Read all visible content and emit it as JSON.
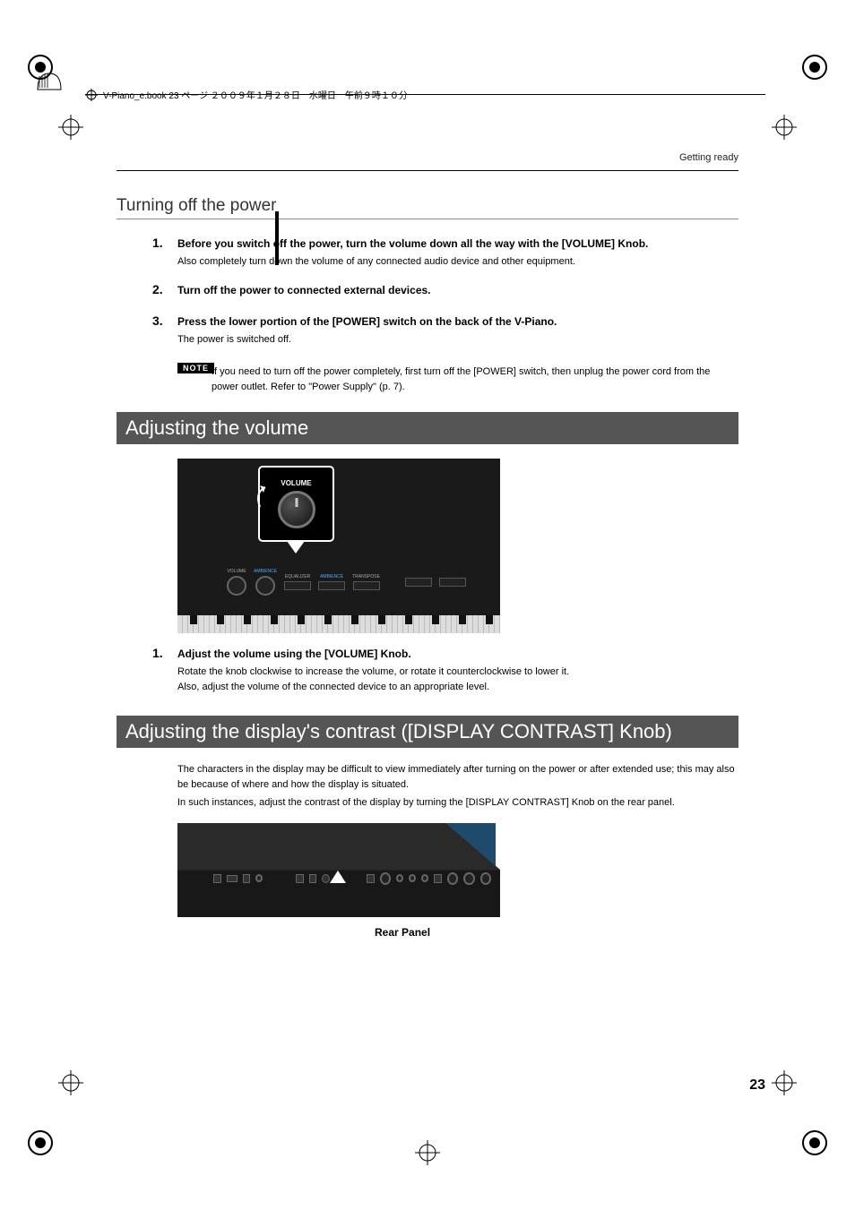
{
  "header": {
    "text": "V-Piano_e.book 23 ページ ２００９年１月２８日　水曜日　午前９時１０分"
  },
  "running_head": "Getting ready",
  "section_turning_off": {
    "title": "Turning off the power",
    "steps": [
      {
        "num": "1.",
        "title": "Before you switch off the power, turn the volume down all the way with the [VOLUME] Knob.",
        "body": "Also completely turn down the volume of any connected audio device and other equipment."
      },
      {
        "num": "2.",
        "title": "Turn off the power to connected external devices.",
        "body": ""
      },
      {
        "num": "3.",
        "title": "Press the lower portion of the [POWER] switch on the back of the V-Piano.",
        "body": "The power is switched off."
      }
    ],
    "note_tag": "NOTE",
    "note_text": "If you need to turn off the power completely, first turn off the [POWER] switch, then unplug the power cord from the power outlet. Refer to  \"Power Supply\" (p. 7)."
  },
  "section_volume": {
    "title": "Adjusting the volume",
    "figure_labels": {
      "callout": "VOLUME",
      "volume": "VOLUME",
      "ambience": "AMBIENCE",
      "equalizer": "EQUALIZER",
      "ambience2": "AMBIENCE",
      "transpose": "TRANSPOSE"
    },
    "steps": [
      {
        "num": "1.",
        "title": "Adjust the volume using the [VOLUME] Knob.",
        "body1": "Rotate the knob clockwise to increase the volume, or rotate it counterclockwise to lower it.",
        "body2": "Also, adjust the volume of the connected device to an appropriate level."
      }
    ]
  },
  "section_contrast": {
    "title": "Adjusting the display's contrast ([DISPLAY CONTRAST] Knob)",
    "body1": "The characters in the display may be difficult to view immediately after turning on the power or after extended use; this may also be because of where and how the display is situated.",
    "body2": "In such instances, adjust the contrast of the display by turning the [DISPLAY CONTRAST] Knob on the rear panel.",
    "rear_caption": "Rear Panel"
  },
  "page_number": "23"
}
